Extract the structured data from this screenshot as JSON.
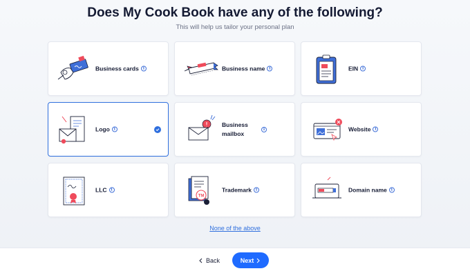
{
  "header": {
    "title": "Does My Cook Book have any of the following?",
    "subtitle": "This will help us tailor your personal plan"
  },
  "options": [
    {
      "label": "Business cards",
      "icon": "business-cards-icon",
      "selected": false
    },
    {
      "label": "Business name",
      "icon": "business-name-icon",
      "selected": false
    },
    {
      "label": "EIN",
      "icon": "ein-icon",
      "selected": false
    },
    {
      "label": "Logo",
      "icon": "logo-icon",
      "selected": true
    },
    {
      "label": "Business mailbox",
      "icon": "mailbox-icon",
      "selected": false
    },
    {
      "label": "Website",
      "icon": "website-icon",
      "selected": false
    },
    {
      "label": "LLC",
      "icon": "llc-certificate-icon",
      "selected": false
    },
    {
      "label": "Trademark",
      "icon": "trademark-icon",
      "selected": false
    },
    {
      "label": "Domain name",
      "icon": "domain-name-icon",
      "selected": false
    }
  ],
  "info_glyph": "i",
  "none_link": "None of the above",
  "footer": {
    "back_label": "Back",
    "next_label": "Next",
    "back_icon": "chevron-left-icon",
    "next_icon": "chevron-right-icon"
  },
  "colors": {
    "accent": "#1f6bff",
    "selected_border": "#2f6fde",
    "illustration_red": "#ef4b5b",
    "illustration_blue": "#3f6fd8"
  }
}
